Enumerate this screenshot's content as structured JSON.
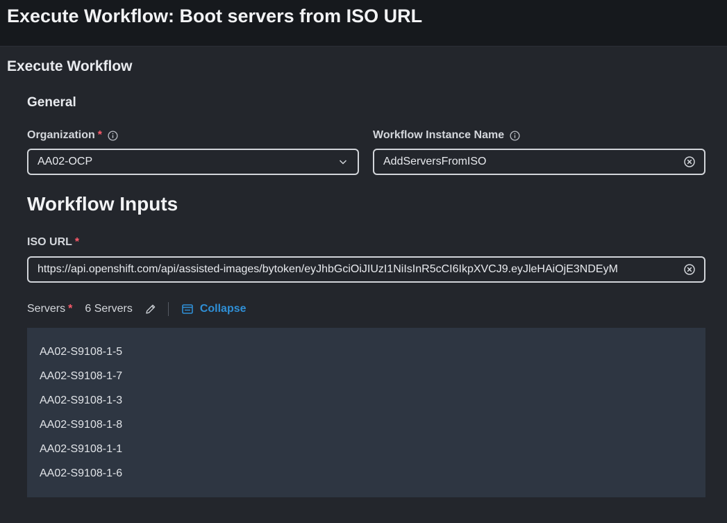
{
  "header": {
    "title": "Execute Workflow: Boot servers from ISO URL"
  },
  "main": {
    "section_title": "Execute Workflow",
    "general": {
      "title": "General",
      "organization": {
        "label": "Organization",
        "required_mark": "*",
        "value": "AA02-OCP"
      },
      "instance_name": {
        "label": "Workflow Instance Name",
        "value": "AddServersFromISO"
      }
    },
    "inputs": {
      "title": "Workflow Inputs",
      "iso_url": {
        "label": "ISO URL",
        "required_mark": "*",
        "value": "https://api.openshift.com/api/assisted-images/bytoken/eyJhbGciOiJIUzI1NiIsInR5cCI6IkpXVCJ9.eyJleHAiOjE3NDEyM"
      },
      "servers": {
        "label": "Servers",
        "required_mark": "*",
        "count_text": "6 Servers",
        "collapse_label": "Collapse",
        "items": [
          "AA02-S9108-1-5",
          "AA02-S9108-1-7",
          "AA02-S9108-1-3",
          "AA02-S9108-1-8",
          "AA02-S9108-1-1",
          "AA02-S9108-1-6"
        ]
      }
    }
  },
  "icons": {
    "info": "info-icon",
    "dropdown": "chevron-down-icon",
    "clear": "clear-icon",
    "edit": "pencil-icon",
    "collapse": "collapse-icon"
  },
  "colors": {
    "background": "#23262c",
    "header_background": "#16191d",
    "required": "#ff5a6a",
    "link": "#2f8fd6",
    "list_background": "#2e3642"
  }
}
